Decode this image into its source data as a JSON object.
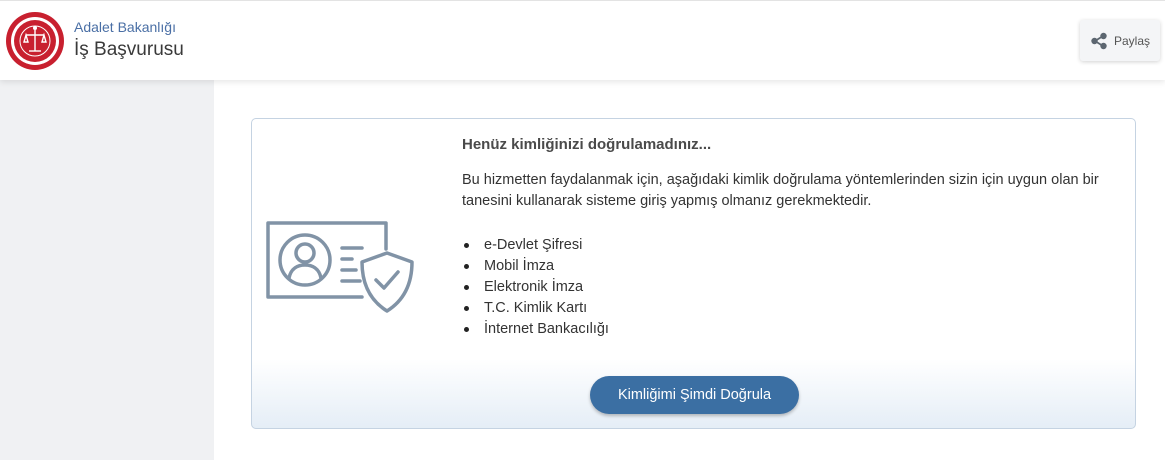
{
  "header": {
    "org_name": "Adalet Bakanlığı",
    "service_title": "İş Başvurusu",
    "share_label": "Paylaş",
    "logo_icon": "ministry-emblem-icon",
    "share_icon": "share-icon"
  },
  "card": {
    "heading": "Henüz kimliğinizi doğrulamadınız...",
    "description": "Bu hizmetten faydalanmak için, aşağıdaki kimlik doğrulama yöntemlerinden sizin için uygun olan bir tanesini kullanarak sisteme giriş yapmış olmanız gerekmektedir.",
    "methods": [
      "e-Devlet Şifresi",
      "Mobil İmza",
      "Elektronik İmza",
      "T.C. Kimlik Kartı",
      "İnternet Bankacılığı"
    ],
    "verify_button": "Kimliğimi Şimdi Doğrula",
    "illustration_icon": "verified-id-card-icon"
  },
  "colors": {
    "accent": "#3b6fa3",
    "emblem_red": "#c8202f",
    "illustration": "#8193a6",
    "sidebar": "#f0f1f3"
  }
}
